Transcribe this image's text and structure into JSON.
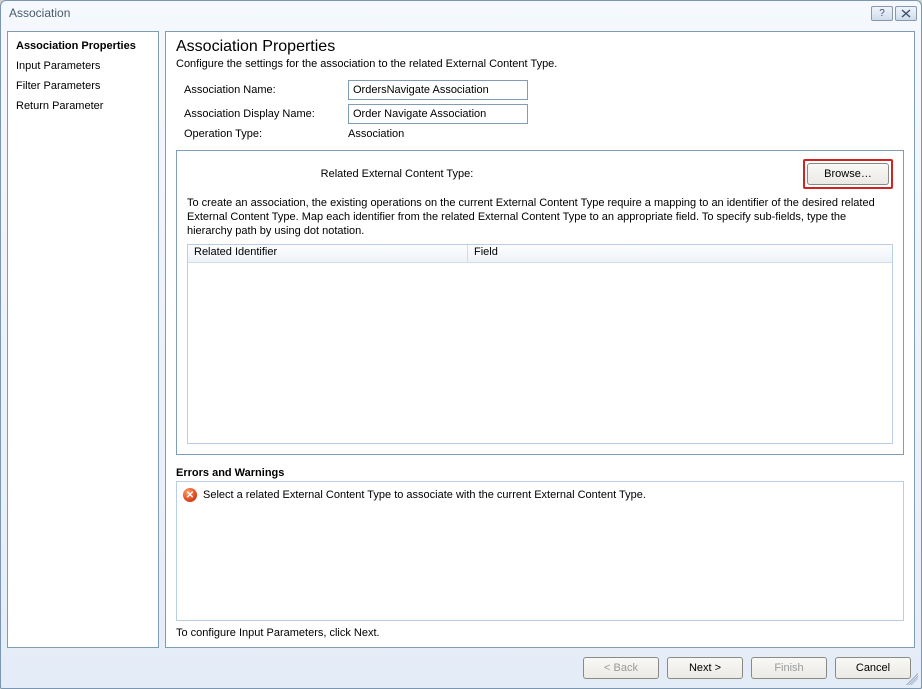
{
  "window": {
    "title": "Association"
  },
  "sidebar": {
    "items": [
      {
        "label": "Association Properties",
        "active": true
      },
      {
        "label": "Input Parameters",
        "active": false
      },
      {
        "label": "Filter Parameters",
        "active": false
      },
      {
        "label": "Return Parameter",
        "active": false
      }
    ]
  },
  "page": {
    "title": "Association Properties",
    "subtitle": "Configure the settings for the association to the related External Content Type."
  },
  "form": {
    "assoc_name_label": "Association Name:",
    "assoc_name_value": "OrdersNavigate Association",
    "assoc_display_label": "Association Display Name:",
    "assoc_display_value": "Order Navigate Association",
    "op_type_label": "Operation Type:",
    "op_type_value": "Association"
  },
  "panel": {
    "related_label": "Related External Content Type:",
    "browse_label": "Browse…",
    "description": "To create an association, the existing operations on the current External Content Type require a mapping to an identifier of the desired related External Content Type. Map each identifier from the related External Content Type to an appropriate field. To specify sub-fields, type the hierarchy path by using dot notation.",
    "columns": {
      "col1": "Related Identifier",
      "col2": "Field"
    }
  },
  "errors": {
    "heading": "Errors and Warnings",
    "items": [
      {
        "icon": "x",
        "text": "Select a related External Content Type to associate with the current External Content Type."
      }
    ]
  },
  "hint": "To configure Input Parameters, click Next.",
  "buttons": {
    "back": "< Back",
    "next": "Next >",
    "finish": "Finish",
    "cancel": "Cancel"
  }
}
